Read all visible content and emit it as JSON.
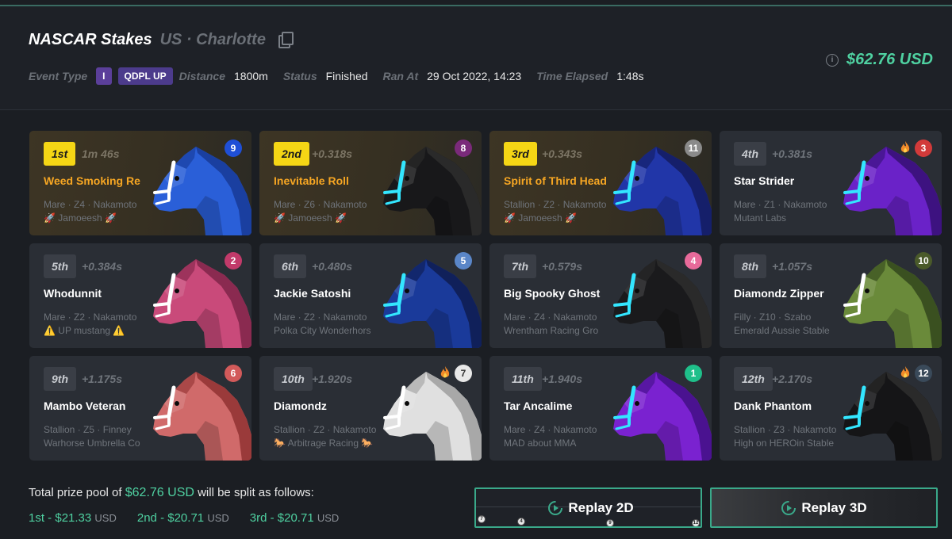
{
  "event": {
    "title": "NASCAR Stakes",
    "location": "US · Charlotte",
    "prize": "$62.76 USD",
    "info_icon": "i",
    "meta": {
      "event_type_label": "Event Type",
      "event_type_chip1": "I",
      "event_type_chip2": "QDPL UP",
      "distance_label": "Distance",
      "distance_value": "1800m",
      "status_label": "Status",
      "status_value": "Finished",
      "ran_at_label": "Ran At",
      "ran_at_value": "29 Oct 2022, 14:23",
      "time_elapsed_label": "Time Elapsed",
      "time_elapsed_value": "1:48s"
    }
  },
  "results": [
    {
      "pos": "1st",
      "gap": "1m 46s",
      "name": "Weed Smoking Re",
      "info": "Mare · Z4 · Nakamoto",
      "owner": "🚀 Jamoeesh 🚀",
      "gate": "9",
      "gate_color": "#1f4fd6",
      "horse_color": "#2a5fd8",
      "mane_color": "#1a3fa0",
      "bridle": "white",
      "fire": false,
      "gold": true
    },
    {
      "pos": "2nd",
      "gap": "+0.318s",
      "name": "Inevitable Roll",
      "info": "Mare · Z6 · Nakamoto",
      "owner": "🚀 Jamoeesh 🚀",
      "gate": "8",
      "gate_color": "#7a2a7a",
      "horse_color": "#18181a",
      "mane_color": "#2a2a2a",
      "bridle": "cyan",
      "fire": false,
      "gold": true
    },
    {
      "pos": "3rd",
      "gap": "+0.343s",
      "name": "Spirit of Third Head",
      "info": "Stallion · Z2 · Nakamoto",
      "owner": "🚀 Jamoeesh 🚀",
      "gate": "11",
      "gate_color": "#8a8a8a",
      "horse_color": "#2136a8",
      "mane_color": "#151f6a",
      "bridle": "cyan",
      "fire": false,
      "gold": true
    },
    {
      "pos": "4th",
      "gap": "+0.381s",
      "name": "Star Strider",
      "info": "Mare · Z1 · Nakamoto",
      "owner": "Mutant Labs",
      "gate": "3",
      "gate_color": "#d23a3a",
      "horse_color": "#6a22c8",
      "mane_color": "#3d1280",
      "bridle": "cyan",
      "fire": true,
      "gold": false
    },
    {
      "pos": "5th",
      "gap": "+0.384s",
      "name": "Whodunnit",
      "info": "Mare · Z2 · Nakamoto",
      "owner": "⚠️ UP mustang ⚠️",
      "gate": "2",
      "gate_color": "#c23a6a",
      "horse_color": "#c94a7a",
      "mane_color": "#8a2a50",
      "bridle": "white",
      "fire": false,
      "gold": false
    },
    {
      "pos": "6th",
      "gap": "+0.480s",
      "name": "Jackie Satoshi",
      "info": "Mare · Z2 · Nakamoto",
      "owner": "Polka City Wonderhors",
      "gate": "5",
      "gate_color": "#5a86c8",
      "horse_color": "#1a3a9a",
      "mane_color": "#10205a",
      "bridle": "cyan",
      "fire": false,
      "gold": false
    },
    {
      "pos": "7th",
      "gap": "+0.579s",
      "name": "Big Spooky Ghost",
      "info": "Mare · Z4 · Nakamoto",
      "owner": "Wrentham Racing Gro",
      "gate": "4",
      "gate_color": "#e86a9a",
      "horse_color": "#1a1a1c",
      "mane_color": "#2a2a2a",
      "bridle": "cyan",
      "fire": false,
      "gold": false
    },
    {
      "pos": "8th",
      "gap": "+1.057s",
      "name": "Diamondz Zipper",
      "info": "Filly · Z10 · Szabo",
      "owner": "Emerald Aussie Stable",
      "gate": "10",
      "gate_color": "#4a5a2a",
      "horse_color": "#6a8a3a",
      "mane_color": "#3a5020",
      "bridle": "white",
      "fire": false,
      "gold": false
    },
    {
      "pos": "9th",
      "gap": "+1.175s",
      "name": "Mambo Veteran",
      "info": "Stallion · Z5 · Finney",
      "owner": "Warhorse Umbrella Co",
      "gate": "6",
      "gate_color": "#d25a5a",
      "horse_color": "#d06a6a",
      "mane_color": "#9a3a3a",
      "bridle": "white",
      "fire": false,
      "gold": false
    },
    {
      "pos": "10th",
      "gap": "+1.920s",
      "name": "Diamondz",
      "info": "Stallion · Z2 · Nakamoto",
      "owner": "🐎 Arbitrage Racing 🐎",
      "gate": "7",
      "gate_color": "#e8e8e8",
      "horse_color": "#e0e0e0",
      "mane_color": "#a8a8a8",
      "bridle": "white",
      "fire": true,
      "gold": false
    },
    {
      "pos": "11th",
      "gap": "+1.940s",
      "name": "Tar Ancalime",
      "info": "Mare · Z4 · Nakamoto",
      "owner": "MAD about MMA",
      "gate": "1",
      "gate_color": "#1fbf8a",
      "horse_color": "#7a22d0",
      "mane_color": "#4a1290",
      "bridle": "cyan",
      "fire": false,
      "gold": false
    },
    {
      "pos": "12th",
      "gap": "+2.170s",
      "name": "Dank Phantom",
      "info": "Stallion · Z3 · Nakamoto",
      "owner": "High on HEROin Stable",
      "gate": "12",
      "gate_color": "#3a4a5a",
      "horse_color": "#151517",
      "mane_color": "#2a2a2a",
      "bridle": "cyan",
      "fire": true,
      "gold": false
    }
  ],
  "prize_split": {
    "intro_prefix": "Total prize pool of",
    "intro_amount": "$62.76 USD",
    "intro_suffix": "will be split as follows:",
    "splits": [
      {
        "label": "1st -",
        "amount": "$21.33",
        "unit": "USD"
      },
      {
        "label": "2nd -",
        "amount": "$20.71",
        "unit": "USD"
      },
      {
        "label": "3rd -",
        "amount": "$20.71",
        "unit": "USD"
      }
    ]
  },
  "replay": {
    "replay_2d_label": "Replay 2D",
    "replay_3d_label": "Replay 3D",
    "track_dots": [
      "7",
      "4",
      "9",
      "12"
    ]
  },
  "colors": {
    "accent_green": "#4fd1a1",
    "gold_badge": "#f5d615",
    "gold_name": "#f6a623"
  }
}
